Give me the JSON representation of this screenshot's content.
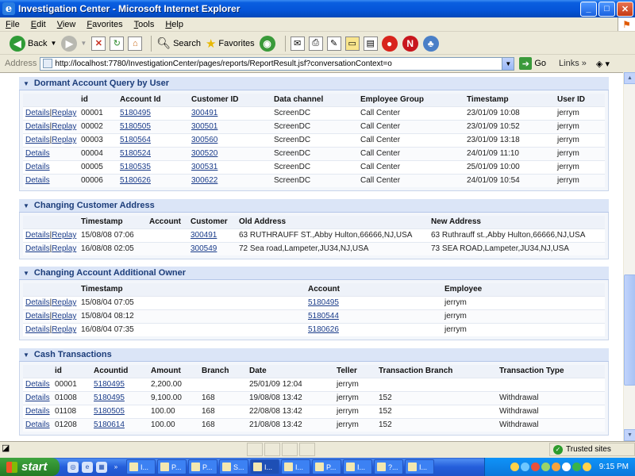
{
  "window": {
    "title": "Investigation Center - Microsoft Internet Explorer"
  },
  "menu": [
    "File",
    "Edit",
    "View",
    "Favorites",
    "Tools",
    "Help"
  ],
  "toolbar": {
    "back": "Back",
    "search": "Search",
    "favorites": "Favorites"
  },
  "address": {
    "label": "Address",
    "url": "http://localhost:7780/InvestigationCenter/pages/reports/ReportResult.jsf?conversationContext=o",
    "go": "Go",
    "links": "Links"
  },
  "sections": {
    "dormant": {
      "title": "Dormant Account Query by User",
      "headers": [
        "",
        "id",
        "Account Id",
        "Customer ID",
        "Data channel",
        "Employee Group",
        "Timestamp",
        "User ID"
      ],
      "rows": [
        {
          "actions": [
            "Details",
            "Replay"
          ],
          "id": "00001",
          "account": "5180495",
          "customer": "300491",
          "channel": "ScreenDC",
          "group": "Call Center",
          "timestamp": "23/01/09 10:08",
          "user": "jerrym"
        },
        {
          "actions": [
            "Details",
            "Replay"
          ],
          "id": "00002",
          "account": "5180505",
          "customer": "300501",
          "channel": "ScreenDC",
          "group": "Call Center",
          "timestamp": "23/01/09 10:52",
          "user": "jerrym"
        },
        {
          "actions": [
            "Details",
            "Replay"
          ],
          "id": "00003",
          "account": "5180564",
          "customer": "300560",
          "channel": "ScreenDC",
          "group": "Call Center",
          "timestamp": "23/01/09 13:18",
          "user": "jerrym"
        },
        {
          "actions": [
            "Details"
          ],
          "id": "00004",
          "account": "5180524",
          "customer": "300520",
          "channel": "ScreenDC",
          "group": "Call Center",
          "timestamp": "24/01/09 11:10",
          "user": "jerrym"
        },
        {
          "actions": [
            "Details"
          ],
          "id": "00005",
          "account": "5180535",
          "customer": "300531",
          "channel": "ScreenDC",
          "group": "Call Center",
          "timestamp": "25/01/09 10:00",
          "user": "jerrym"
        },
        {
          "actions": [
            "Details"
          ],
          "id": "00006",
          "account": "5180626",
          "customer": "300622",
          "channel": "ScreenDC",
          "group": "Call Center",
          "timestamp": "24/01/09 10:54",
          "user": "jerrym"
        }
      ]
    },
    "address_change": {
      "title": "Changing Customer Address",
      "headers": [
        "",
        "Timestamp",
        "Account",
        "Customer",
        "Old Address",
        "New Address"
      ],
      "rows": [
        {
          "actions": [
            "Details",
            "Replay"
          ],
          "timestamp": "15/08/08 07:06",
          "account": "",
          "customer": "300491",
          "old": "63 RUTHRAUFF ST.,Abby Hulton,66666,NJ,USA",
          "new": "63 Ruthrauff st.,Abby Hulton,66666,NJ,USA"
        },
        {
          "actions": [
            "Details",
            "Replay"
          ],
          "timestamp": "16/08/08 02:05",
          "account": "",
          "customer": "300549",
          "old": "72 Sea road,Lampeter,JU34,NJ,USA",
          "new": "73 SEA ROAD,Lampeter,JU34,NJ,USA"
        }
      ]
    },
    "owner_change": {
      "title": "Changing Account Additional Owner",
      "headers": [
        "",
        "Timestamp",
        "Account",
        "Employee"
      ],
      "rows": [
        {
          "actions": [
            "Details",
            "Replay"
          ],
          "timestamp": "15/08/04 07:05",
          "account": "5180495",
          "employee": "jerrym"
        },
        {
          "actions": [
            "Details",
            "Replay"
          ],
          "timestamp": "15/08/04 08:12",
          "account": "5180544",
          "employee": "jerrym"
        },
        {
          "actions": [
            "Details",
            "Replay"
          ],
          "timestamp": "16/08/04 07:35",
          "account": "5180626",
          "employee": "jerrym"
        }
      ]
    },
    "cash": {
      "title": "Cash Transactions",
      "headers": [
        "",
        "id",
        "Acountid",
        "Amount",
        "Branch",
        "Date",
        "Teller",
        "Transaction Branch",
        "Transaction Type"
      ],
      "rows": [
        {
          "actions": [
            "Details"
          ],
          "id": "00001",
          "account": "5180495",
          "amount": "2,200.00",
          "branch": "",
          "date": "25/01/09 12:04",
          "teller": "jerrym",
          "tbranch": "",
          "type": ""
        },
        {
          "actions": [
            "Details"
          ],
          "id": "01008",
          "account": "5180495",
          "amount": "9,100.00",
          "branch": "168",
          "date": "19/08/08 13:42",
          "teller": "jerrym",
          "tbranch": "152",
          "type": "Withdrawal"
        },
        {
          "actions": [
            "Details"
          ],
          "id": "01108",
          "account": "5180505",
          "amount": "100.00",
          "branch": "168",
          "date": "22/08/08 13:42",
          "teller": "jerrym",
          "tbranch": "152",
          "type": "Withdrawal"
        },
        {
          "actions": [
            "Details"
          ],
          "id": "01208",
          "account": "5180614",
          "amount": "100.00",
          "branch": "168",
          "date": "21/08/08 13:42",
          "teller": "jerrym",
          "tbranch": "152",
          "type": "Withdrawal"
        }
      ]
    }
  },
  "status": {
    "zone": "Trusted sites"
  },
  "taskbar": {
    "start": "start",
    "tasks": [
      "I...",
      "P...",
      "P...",
      "S...",
      "I...",
      "I...",
      "P...",
      "I...",
      "?...",
      "I..."
    ],
    "clock": "9:15 PM"
  }
}
